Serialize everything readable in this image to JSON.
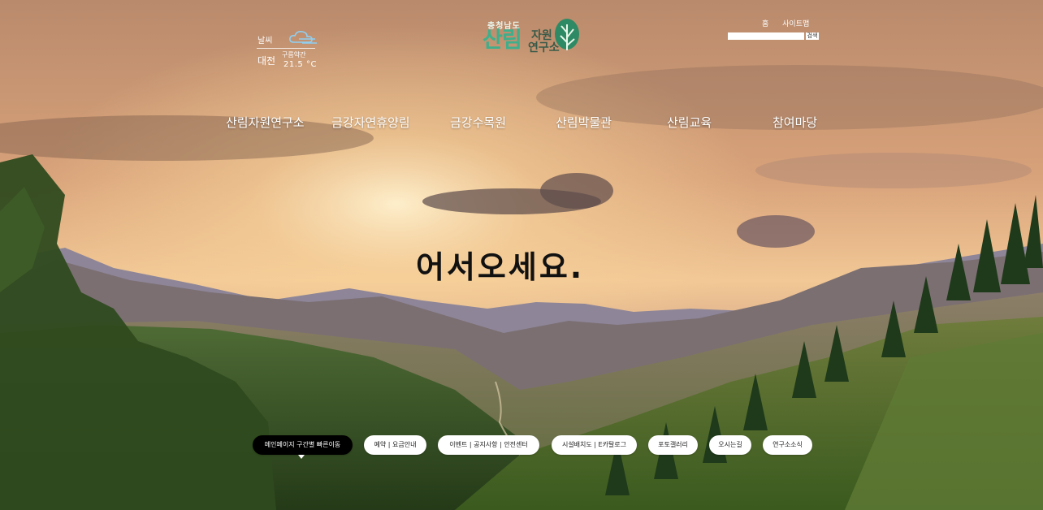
{
  "weather": {
    "label": "날씨",
    "city": "대전",
    "condition": "구름약간",
    "temperature": "21.5 °C",
    "icon": "cloud-icon"
  },
  "logo": {
    "province": "충청남도",
    "name_big": "산림",
    "name_line1": "자원",
    "name_line2": "연구소",
    "icon": "tree-leaf-icon"
  },
  "utility": {
    "home": "홈",
    "sitemap": "사이트맵",
    "search_placeholder": "",
    "search_button": "검색"
  },
  "gnb": [
    "산림자원연구소",
    "금강자연휴양림",
    "금강수목원",
    "산림박물관",
    "산림교육",
    "참여마당"
  ],
  "hero": {
    "headline": "어서오세요."
  },
  "quick_links": [
    "메인페이지 구간별 빠른이동",
    "예약 | 요금안내",
    "이벤트 | 공지사항 | 안전센터",
    "시설배치도 | E카탈로그",
    "포토갤러리",
    "오시는길",
    "연구소소식"
  ],
  "colors": {
    "logo_green": "#3fae8b",
    "sky_top": "#c98f63",
    "sun_glow": "#fde0a6"
  }
}
